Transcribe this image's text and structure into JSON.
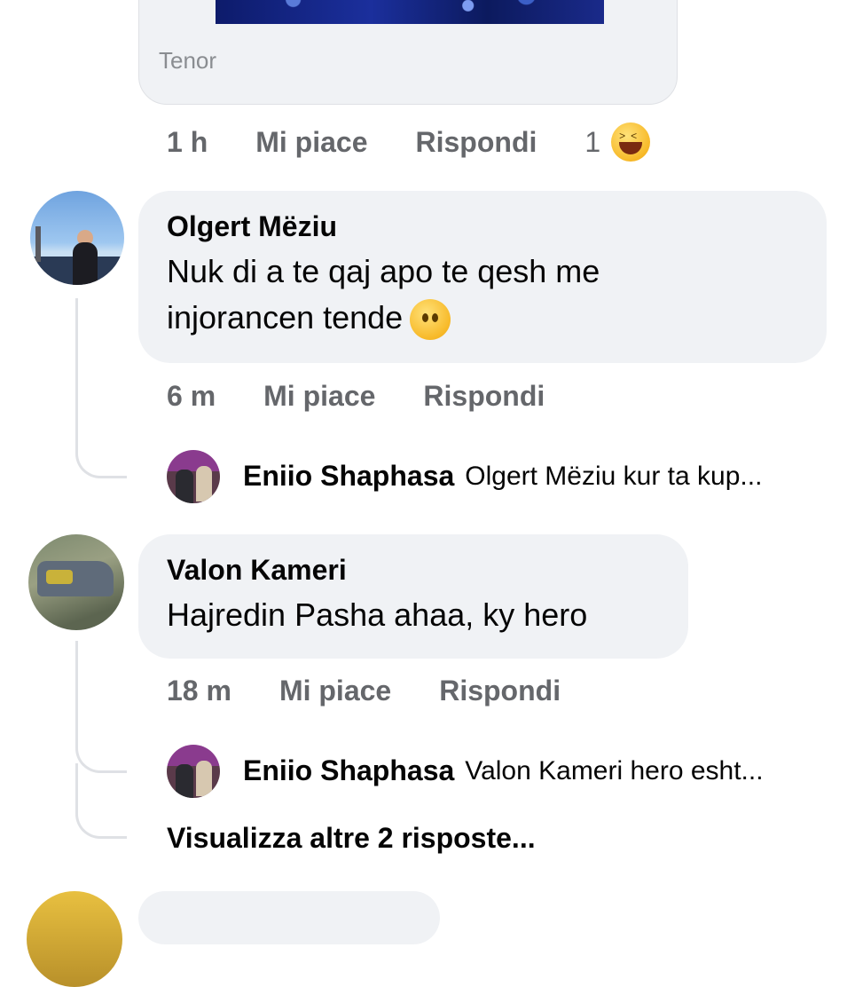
{
  "gif_card": {
    "source_label": "Tenor"
  },
  "first_comment_meta": {
    "time": "1 h",
    "like_label": "Mi piace",
    "reply_label": "Rispondi",
    "reaction_count": "1",
    "reaction_icon": "haha-icon"
  },
  "comments": [
    {
      "author": "Olgert Mëziu",
      "text_line1": "Nuk di a te qaj apo te qesh me",
      "text_line2": "injorancen tende",
      "emoji": "neutral-face-icon",
      "time": "6 m",
      "like_label": "Mi piace",
      "reply_label": "Rispondi",
      "reply_preview": {
        "author": "Eniio Shaphasa",
        "text": "Olgert Mëziu kur ta kup..."
      }
    },
    {
      "author": "Valon Kameri",
      "text_line1": "Hajredin Pasha ahaa, ky hero",
      "time": "18 m",
      "like_label": "Mi piace",
      "reply_label": "Rispondi",
      "reply_preview": {
        "author": "Eniio Shaphasa",
        "text": "Valon Kameri hero esht..."
      },
      "more_replies": "Visualizza altre 2 risposte..."
    }
  ],
  "colors": {
    "bubble_bg": "#f0f2f5",
    "meta_text": "#65676b",
    "primary_text": "#050505",
    "thread_line": "#dfe1e5"
  }
}
